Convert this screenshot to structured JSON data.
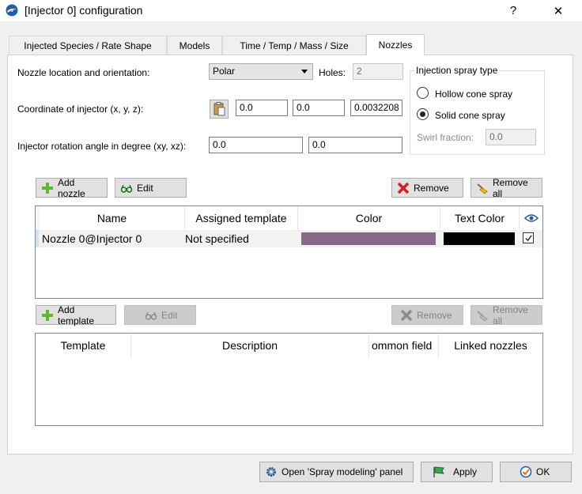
{
  "window": {
    "title": "[Injector 0] configuration",
    "help_label": "?",
    "close_label": "✕"
  },
  "tabs": [
    {
      "label": "Injected Species / Rate Shape"
    },
    {
      "label": "Models"
    },
    {
      "label": "Time / Temp / Mass / Size"
    },
    {
      "label": "Nozzles"
    }
  ],
  "nozzle_location": {
    "label": "Nozzle location and orientation:",
    "value": "Polar",
    "holes_label": "Holes:",
    "holes_value": "2"
  },
  "coordinate": {
    "label": "Coordinate of injector (x, y, z):",
    "x": "0.0",
    "y": "0.0",
    "z": "0.0032208"
  },
  "rotation": {
    "label": "Injector rotation angle in degree (xy, xz):",
    "xy": "0.0",
    "xz": "0.0"
  },
  "spray_type": {
    "title": "Injection spray type",
    "hollow_label": "Hollow cone spray",
    "solid_label": "Solid cone spray",
    "selected": "solid",
    "swirl_label": "Swirl fraction:",
    "swirl_value": "0.0"
  },
  "nozzle_toolbar": {
    "add": "Add nozzle",
    "edit": "Edit",
    "remove": "Remove",
    "remove_all": "Remove all"
  },
  "nozzle_table": {
    "headers": {
      "name": "Name",
      "template": "Assigned template",
      "color": "Color",
      "text_color": "Text Color"
    },
    "rows": [
      {
        "name": "Nozzle 0@Injector 0",
        "template": "Not specified",
        "color": "#876a86",
        "text_color": "#000000",
        "visible": true
      }
    ]
  },
  "template_toolbar": {
    "add": "Add template",
    "edit": "Edit",
    "remove": "Remove",
    "remove_all": "Remove all"
  },
  "template_table": {
    "headers": {
      "template": "Template",
      "description": "Description",
      "common": "ommon field",
      "linked": "Linked nozzles"
    }
  },
  "footer": {
    "open_panel": "Open 'Spray modeling' panel",
    "apply": "Apply",
    "ok": "OK"
  }
}
